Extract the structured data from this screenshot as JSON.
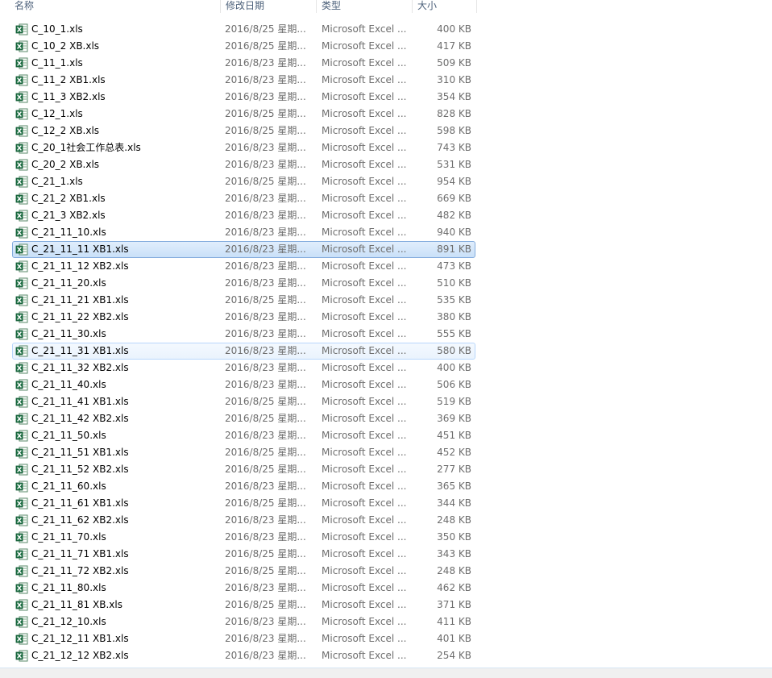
{
  "columns": {
    "name": "名称",
    "date": "修改日期",
    "type": "类型",
    "size": "大小"
  },
  "files": [
    {
      "name": "C_10_1.xls",
      "date": "2016/8/25 星期...",
      "type": "Microsoft Excel ...",
      "size": "400 KB"
    },
    {
      "name": "C_10_2 XB.xls",
      "date": "2016/8/25 星期...",
      "type": "Microsoft Excel ...",
      "size": "417 KB"
    },
    {
      "name": "C_11_1.xls",
      "date": "2016/8/23 星期...",
      "type": "Microsoft Excel ...",
      "size": "509 KB"
    },
    {
      "name": "C_11_2 XB1.xls",
      "date": "2016/8/23 星期...",
      "type": "Microsoft Excel ...",
      "size": "310 KB"
    },
    {
      "name": "C_11_3 XB2.xls",
      "date": "2016/8/23 星期...",
      "type": "Microsoft Excel ...",
      "size": "354 KB"
    },
    {
      "name": "C_12_1.xls",
      "date": "2016/8/25 星期...",
      "type": "Microsoft Excel ...",
      "size": "828 KB"
    },
    {
      "name": "C_12_2 XB.xls",
      "date": "2016/8/25 星期...",
      "type": "Microsoft Excel ...",
      "size": "598 KB"
    },
    {
      "name": "C_20_1社会工作总表.xls",
      "date": "2016/8/23 星期...",
      "type": "Microsoft Excel ...",
      "size": "743 KB"
    },
    {
      "name": "C_20_2 XB.xls",
      "date": "2016/8/23 星期...",
      "type": "Microsoft Excel ...",
      "size": "531 KB"
    },
    {
      "name": "C_21_1.xls",
      "date": "2016/8/25 星期...",
      "type": "Microsoft Excel ...",
      "size": "954 KB"
    },
    {
      "name": "C_21_2 XB1.xls",
      "date": "2016/8/23 星期...",
      "type": "Microsoft Excel ...",
      "size": "669 KB"
    },
    {
      "name": "C_21_3 XB2.xls",
      "date": "2016/8/23 星期...",
      "type": "Microsoft Excel ...",
      "size": "482 KB"
    },
    {
      "name": "C_21_11_10.xls",
      "date": "2016/8/23 星期...",
      "type": "Microsoft Excel ...",
      "size": "940 KB"
    },
    {
      "name": "C_21_11_11 XB1.xls",
      "date": "2016/8/23 星期...",
      "type": "Microsoft Excel ...",
      "size": "891 KB",
      "state": "selected"
    },
    {
      "name": "C_21_11_12 XB2.xls",
      "date": "2016/8/23 星期...",
      "type": "Microsoft Excel ...",
      "size": "473 KB"
    },
    {
      "name": "C_21_11_20.xls",
      "date": "2016/8/23 星期...",
      "type": "Microsoft Excel ...",
      "size": "510 KB"
    },
    {
      "name": "C_21_11_21 XB1.xls",
      "date": "2016/8/25 星期...",
      "type": "Microsoft Excel ...",
      "size": "535 KB"
    },
    {
      "name": "C_21_11_22 XB2.xls",
      "date": "2016/8/23 星期...",
      "type": "Microsoft Excel ...",
      "size": "380 KB"
    },
    {
      "name": "C_21_11_30.xls",
      "date": "2016/8/23 星期...",
      "type": "Microsoft Excel ...",
      "size": "555 KB"
    },
    {
      "name": "C_21_11_31 XB1.xls",
      "date": "2016/8/23 星期...",
      "type": "Microsoft Excel ...",
      "size": "580 KB",
      "state": "hot"
    },
    {
      "name": "C_21_11_32 XB2.xls",
      "date": "2016/8/23 星期...",
      "type": "Microsoft Excel ...",
      "size": "400 KB"
    },
    {
      "name": "C_21_11_40.xls",
      "date": "2016/8/23 星期...",
      "type": "Microsoft Excel ...",
      "size": "506 KB"
    },
    {
      "name": "C_21_11_41 XB1.xls",
      "date": "2016/8/25 星期...",
      "type": "Microsoft Excel ...",
      "size": "519 KB"
    },
    {
      "name": "C_21_11_42 XB2.xls",
      "date": "2016/8/25 星期...",
      "type": "Microsoft Excel ...",
      "size": "369 KB"
    },
    {
      "name": "C_21_11_50.xls",
      "date": "2016/8/23 星期...",
      "type": "Microsoft Excel ...",
      "size": "451 KB"
    },
    {
      "name": "C_21_11_51 XB1.xls",
      "date": "2016/8/25 星期...",
      "type": "Microsoft Excel ...",
      "size": "452 KB"
    },
    {
      "name": "C_21_11_52 XB2.xls",
      "date": "2016/8/25 星期...",
      "type": "Microsoft Excel ...",
      "size": "277 KB"
    },
    {
      "name": "C_21_11_60.xls",
      "date": "2016/8/23 星期...",
      "type": "Microsoft Excel ...",
      "size": "365 KB"
    },
    {
      "name": "C_21_11_61 XB1.xls",
      "date": "2016/8/25 星期...",
      "type": "Microsoft Excel ...",
      "size": "344 KB"
    },
    {
      "name": "C_21_11_62 XB2.xls",
      "date": "2016/8/23 星期...",
      "type": "Microsoft Excel ...",
      "size": "248 KB"
    },
    {
      "name": "C_21_11_70.xls",
      "date": "2016/8/23 星期...",
      "type": "Microsoft Excel ...",
      "size": "350 KB"
    },
    {
      "name": "C_21_11_71 XB1.xls",
      "date": "2016/8/25 星期...",
      "type": "Microsoft Excel ...",
      "size": "343 KB"
    },
    {
      "name": "C_21_11_72 XB2.xls",
      "date": "2016/8/25 星期...",
      "type": "Microsoft Excel ...",
      "size": "248 KB"
    },
    {
      "name": "C_21_11_80.xls",
      "date": "2016/8/23 星期...",
      "type": "Microsoft Excel ...",
      "size": "462 KB"
    },
    {
      "name": "C_21_11_81 XB.xls",
      "date": "2016/8/25 星期...",
      "type": "Microsoft Excel ...",
      "size": "371 KB"
    },
    {
      "name": "C_21_12_10.xls",
      "date": "2016/8/23 星期...",
      "type": "Microsoft Excel ...",
      "size": "411 KB"
    },
    {
      "name": "C_21_12_11 XB1.xls",
      "date": "2016/8/23 星期...",
      "type": "Microsoft Excel ...",
      "size": "401 KB"
    },
    {
      "name": "C_21_12_12 XB2.xls",
      "date": "2016/8/23 星期...",
      "type": "Microsoft Excel ...",
      "size": "254 KB"
    }
  ],
  "icons": {
    "file": "excel-file-icon"
  },
  "colors": {
    "excel_green": "#1e7145",
    "selection_border": "#84acdd",
    "hot_border": "#b8d6fb"
  }
}
